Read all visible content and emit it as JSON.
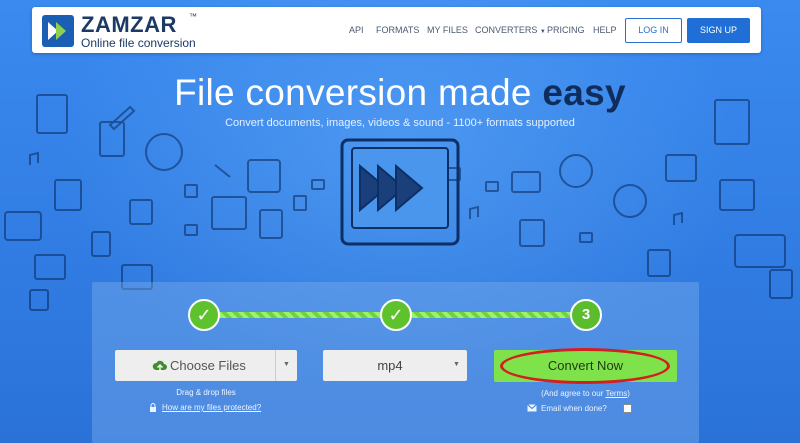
{
  "brand": {
    "name": "ZAMZAR",
    "trademark": "™",
    "tagline": "Online file conversion",
    "accent_color": "#1f6fd6"
  },
  "nav": {
    "items": [
      "API",
      "FORMATS",
      "MY FILES",
      "CONVERTERS",
      "PRICING",
      "HELP"
    ],
    "login": "LOG IN",
    "signup": "SIGN UP"
  },
  "hero": {
    "title_main": "File conversion made ",
    "title_emphasis": "easy",
    "subtitle": "Convert documents, images, videos & sound - 1100+ formats supported"
  },
  "steps": [
    {
      "label": "✓",
      "state": "done"
    },
    {
      "label": "✓",
      "state": "done"
    },
    {
      "label": "3",
      "state": "current"
    }
  ],
  "converter": {
    "choose_files": "Choose Files",
    "format": "mp4",
    "convert": "Convert Now",
    "drag_drop": "Drag & drop files",
    "protected_link": "How are my files protected?",
    "agree_prefix": "(And agree to our ",
    "terms": "Terms",
    "agree_suffix": ")",
    "email_label": "Email when done?"
  },
  "colors": {
    "background": "#2f7fe0",
    "progress_green": "#6ed43a",
    "convert_green": "#7fe24a",
    "highlight_red": "#d21f1f"
  }
}
